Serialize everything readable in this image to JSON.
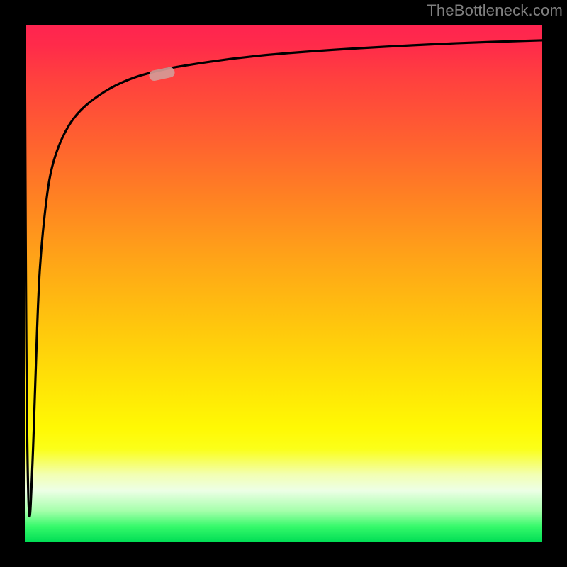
{
  "watermark": "TheBottleneck.com",
  "colors": {
    "background": "#000000",
    "gradient_top": "#ff2450",
    "gradient_bottom": "#00dd55",
    "curve": "#000000",
    "marker": "#d59a96"
  },
  "chart_data": {
    "type": "line",
    "title": "",
    "xlabel": "",
    "ylabel": "",
    "xlim": [
      0,
      100
    ],
    "ylim": [
      0,
      100
    ],
    "grid": false,
    "series": [
      {
        "name": "curve",
        "x": [
          0,
          0.3,
          0.8,
          1.5,
          2.0,
          2.5,
          3.0,
          4.0,
          5.0,
          7.0,
          10.0,
          15.0,
          20.0,
          25.0,
          30.0,
          40.0,
          50.0,
          60.0,
          70.0,
          80.0,
          90.0,
          100.0
        ],
        "y": [
          100,
          30,
          0,
          15,
          30,
          45,
          55,
          65,
          72,
          78,
          83,
          87,
          89.5,
          91,
          92,
          93.5,
          94.5,
          95.2,
          95.8,
          96.3,
          96.7,
          97.0
        ]
      }
    ],
    "annotations": [
      {
        "name": "highlight-marker",
        "x_range": [
          24,
          29
        ],
        "y_range": [
          89.5,
          91.5
        ],
        "style": "pill"
      }
    ]
  }
}
